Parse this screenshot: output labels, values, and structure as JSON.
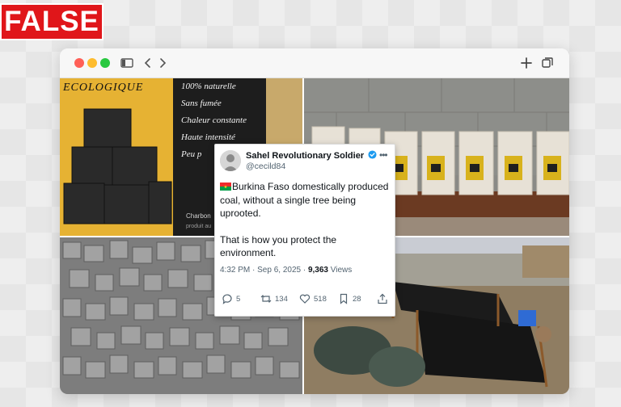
{
  "verdict": {
    "label": "FALSE",
    "color": "#e0161a"
  },
  "browser": {
    "traffic_lights": [
      "#ff5f57",
      "#febc2e",
      "#28c840"
    ],
    "icons": [
      "sidebar-icon",
      "back-icon",
      "forward-icon",
      "new-tab-icon",
      "tabs-overview-icon"
    ]
  },
  "photos": {
    "top_left": {
      "brand": "ECOLOGIQUE",
      "lines": [
        "100% naturelle",
        "Sans fumée",
        "Chaleur constante",
        "Haute intensité",
        "Peu p"
      ],
      "footer": "Charbon",
      "footer2": "produit au"
    }
  },
  "tweet": {
    "author": "Sahel Revolutionary Soldier",
    "handle": "@cecild84",
    "verified": true,
    "flag": "Burkina Faso flag",
    "text_1": "Burkina Faso domestically produced coal, without a single tree being uprooted.",
    "text_2": "That is how you protect the environment.",
    "time": "4:32 PM · Sep 6, 2025 · ",
    "views": "9,363",
    "views_label": " Views",
    "replies": "5",
    "reposts": "134",
    "likes": "518",
    "bookmarks": "28"
  }
}
